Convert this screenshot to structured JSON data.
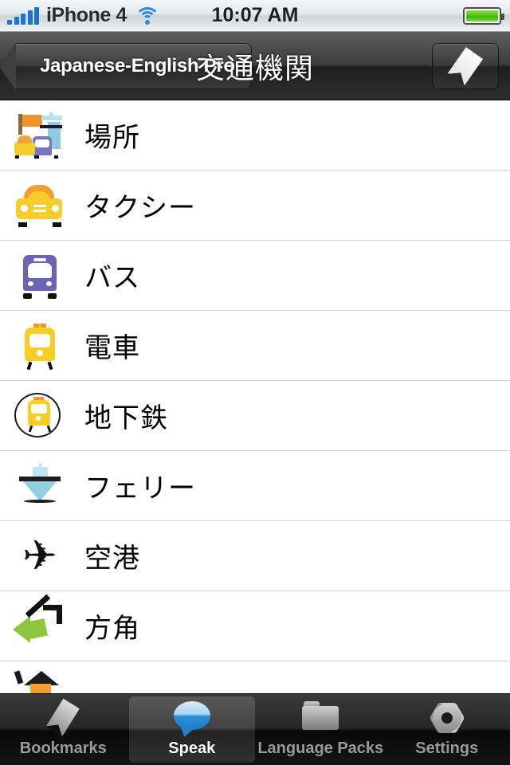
{
  "status_bar": {
    "signal_icon": "signal-bars-icon",
    "carrier": "iPhone 4",
    "wifi_icon": "wifi-icon",
    "time": "10:07 AM",
    "battery_icon": "battery-full-icon"
  },
  "nav_bar": {
    "back_label": "Japanese-English Pro",
    "title": "交通機関",
    "right_button_icon": "bookmark-ribbon-icon"
  },
  "list": {
    "rows": [
      {
        "label": "場所",
        "icon": "places-icon"
      },
      {
        "label": "タクシー",
        "icon": "taxi-icon"
      },
      {
        "label": "バス",
        "icon": "bus-icon"
      },
      {
        "label": "電車",
        "icon": "train-icon"
      },
      {
        "label": "地下鉄",
        "icon": "subway-icon"
      },
      {
        "label": "フェリー",
        "icon": "ferry-icon"
      },
      {
        "label": "空港",
        "icon": "airplane-icon"
      },
      {
        "label": "方角",
        "icon": "direction-arrows-icon"
      },
      {
        "label": "",
        "icon": "house-icon"
      }
    ],
    "airplane_glyph": "✈"
  },
  "tab_bar": {
    "tabs": [
      {
        "label": "Bookmarks",
        "icon": "bookmark-ribbon-icon",
        "selected": false
      },
      {
        "label": "Speak",
        "icon": "speech-bubble-icon",
        "selected": true
      },
      {
        "label": "Language Packs",
        "icon": "folder-icon",
        "selected": false
      },
      {
        "label": "Settings",
        "icon": "gear-icon",
        "selected": false
      }
    ]
  },
  "colors": {
    "accent_blue": "#2a8fd8",
    "taxi_yellow": "#f7cd2c",
    "bus_purple": "#6b63b8",
    "ferry_blue": "#8fd0e3",
    "direction_green": "#8cc63e",
    "flag_orange": "#f0952a",
    "battery_green": "#57c417"
  }
}
